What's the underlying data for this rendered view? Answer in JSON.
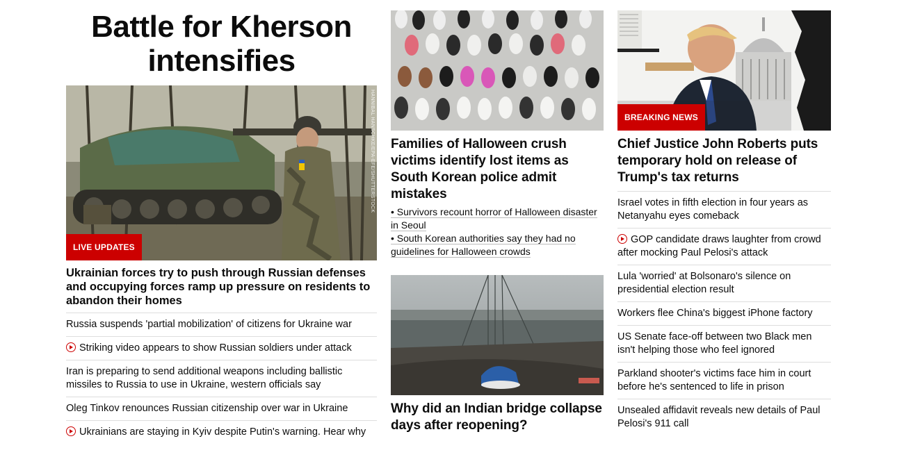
{
  "col1": {
    "title": "Battle for Kherson intensifies",
    "image_credit": "HANNIBAL HANSCHKE/EPA-EFE/SHUTTERSTOCK",
    "badge": "LIVE UPDATES",
    "lead_headline": "Ukrainian forces try to push through Russian defenses and occupying forces ramp up pressure on residents to abandon their homes",
    "stories": [
      {
        "text": "Russia suspends 'partial mobilization' of citizens for Ukraine war",
        "video": false
      },
      {
        "text": "Striking video appears to show Russian soldiers under attack",
        "video": true
      },
      {
        "text": "Iran is preparing to send additional weapons including ballistic missiles to Russia to use in Ukraine, western officials say",
        "video": false
      },
      {
        "text": "Oleg Tinkov renounces Russian citizenship over war in Ukraine",
        "video": false
      },
      {
        "text": "Ukrainians are staying in Kyiv despite Putin's warning. Hear why",
        "video": true
      }
    ]
  },
  "col2": {
    "headline1": "Families of Halloween crush victims identify lost items as South Korean police admit mistakes",
    "bullets": [
      "• Survivors recount horror of Halloween disaster in Seoul",
      "• South Korean authorities say they had no guidelines for Halloween crowds"
    ],
    "headline2": "Why did an Indian bridge collapse days after reopening?"
  },
  "col3": {
    "badge": "BREAKING NEWS",
    "headline": "Chief Justice John Roberts puts temporary hold on release of Trump's tax returns",
    "stories": [
      {
        "text": "Israel votes in fifth election in four years as Netanyahu eyes comeback",
        "video": false
      },
      {
        "text": "GOP candidate draws laughter from crowd after mocking Paul Pelosi's attack",
        "video": true
      },
      {
        "text": "Lula 'worried' at Bolsonaro's silence on presidential election result",
        "video": false
      },
      {
        "text": "Workers flee China's biggest iPhone factory",
        "video": false
      },
      {
        "text": "US Senate face-off between two Black men isn't helping those who feel ignored",
        "video": false
      },
      {
        "text": "Parkland shooter's victims face him in court before he's sentenced to life in prison",
        "video": false
      },
      {
        "text": "Unsealed affidavit reveals new details of Paul Pelosi's 911 call",
        "video": false
      }
    ]
  },
  "colors": {
    "accent": "#cc0000",
    "text": "#0c0c0c",
    "divider": "#dddddd"
  },
  "icons": {
    "video": "play-circle-icon"
  }
}
